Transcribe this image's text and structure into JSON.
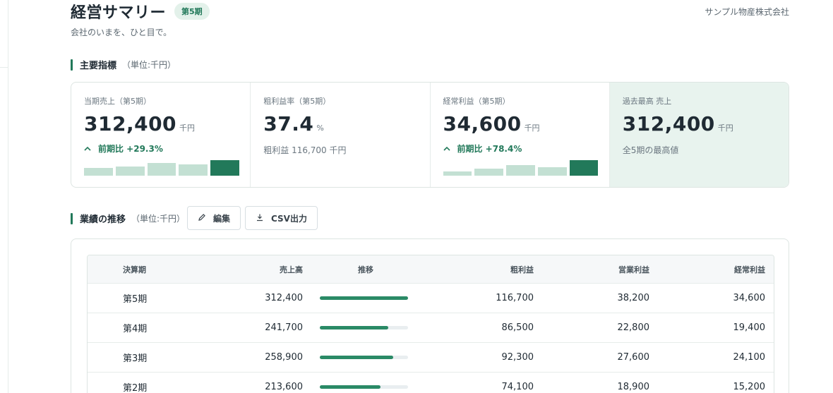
{
  "header": {
    "title": "経営サマリー",
    "period_badge": "第5期",
    "subtitle": "会社のいまを、ひと目で。",
    "company": "サンプル物産株式会社"
  },
  "kpi_section": {
    "title": "主要指標",
    "unit": "（単位:千円）"
  },
  "kpis": [
    {
      "label": "当期売上（第5期）",
      "value": "312,400",
      "unit": "千円",
      "delta_icon": "chevron-up",
      "delta": "前期比 +29.3%",
      "sparkline": [
        0.5,
        0.6,
        0.8,
        0.72,
        1.0
      ]
    },
    {
      "label": "粗利益率（第5期）",
      "value": "37.4",
      "unit": "%",
      "sub": "粗利益 116,700 千円"
    },
    {
      "label": "経常利益（第5期）",
      "value": "34,600",
      "unit": "千円",
      "delta_icon": "chevron-up",
      "delta": "前期比 +78.4%",
      "sparkline": [
        0.28,
        0.44,
        0.7,
        0.56,
        1.0
      ]
    },
    {
      "label": "過去最高 売上",
      "value": "312,400",
      "unit": "千円",
      "sub": "全5期の最高値"
    }
  ],
  "performance_section": {
    "title": "業績の推移",
    "unit": "（単位:千円）",
    "edit_label": "編集",
    "csv_label": "CSV出力"
  },
  "table": {
    "columns": [
      "決算期",
      "売上高",
      "推移",
      "粗利益",
      "営業利益",
      "経常利益"
    ],
    "rows": [
      {
        "period": "第5期",
        "sales": "312,400",
        "trend": 1.0,
        "gross": "116,700",
        "operating": "38,200",
        "ordinary": "34,600"
      },
      {
        "period": "第4期",
        "sales": "241,700",
        "trend": 0.774,
        "gross": "86,500",
        "operating": "22,800",
        "ordinary": "19,400"
      },
      {
        "period": "第3期",
        "sales": "258,900",
        "trend": 0.829,
        "gross": "92,300",
        "operating": "27,600",
        "ordinary": "24,100"
      },
      {
        "period": "第2期",
        "sales": "213,600",
        "trend": 0.684,
        "gross": "74,100",
        "operating": "18,900",
        "ordinary": "15,200"
      }
    ]
  },
  "colors": {
    "accent": "#22795a",
    "accent_light": "#c3e0d3",
    "highlight_bg": "#e8f3ee"
  }
}
